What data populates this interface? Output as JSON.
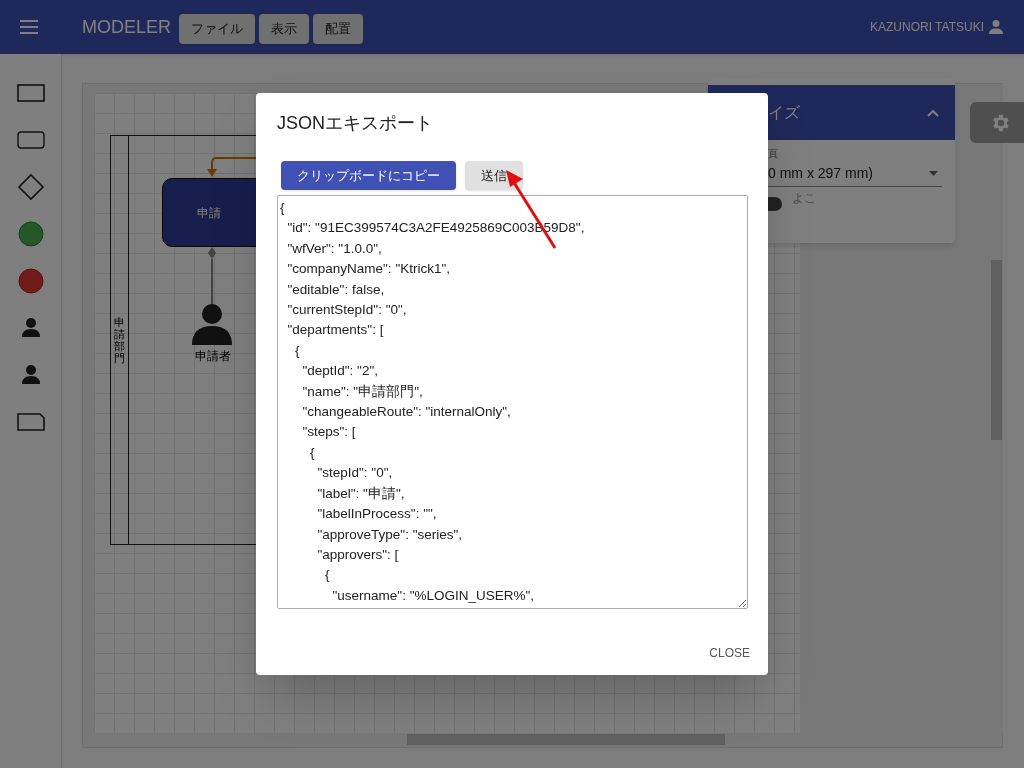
{
  "app_bar": {
    "title": "MODELER",
    "menu_buttons": [
      "ファイル",
      "表示",
      "配置"
    ],
    "user": "KAZUNORI TATSUKI"
  },
  "diagram": {
    "lane_label": "申請部門",
    "step_label": "申請",
    "actor_label": "申請者"
  },
  "paper_panel": {
    "title": "イズ",
    "expanded": true,
    "field_label": "頁",
    "field_value": "0 mm x 297 mm)",
    "toggle_label": "よこ",
    "toggle_on": false
  },
  "dialog": {
    "title": "JSONエキスポート",
    "buttons": [
      {
        "label": "クリップボードにコピー",
        "kind": "primary"
      },
      {
        "label": "送信",
        "kind": "secondary"
      }
    ],
    "json_lines": [
      "{",
      "  \"id\": \"91EC399574C3A2FE4925869C003B59D8\",",
      "  \"wfVer\": \"1.0.0\",",
      "  \"companyName\": \"Ktrick1\",",
      "  \"editable\": false,",
      "  \"currentStepId\": \"0\",",
      "  \"departments\": [",
      "    {",
      "      \"deptId\": \"2\",",
      "      \"name\": \"申請部門\",",
      "      \"changeableRoute\": \"internalOnly\",",
      "      \"steps\": [",
      "        {",
      "          \"stepId\": \"0\",",
      "          \"label\": \"申請\",",
      "          \"labelInProcess\": \"\",",
      "          \"approveType\": \"series\",",
      "          \"approvers\": [",
      "            {",
      "              \"username\": \"%LOGIN_USER%\","
    ],
    "close": "CLOSE"
  }
}
